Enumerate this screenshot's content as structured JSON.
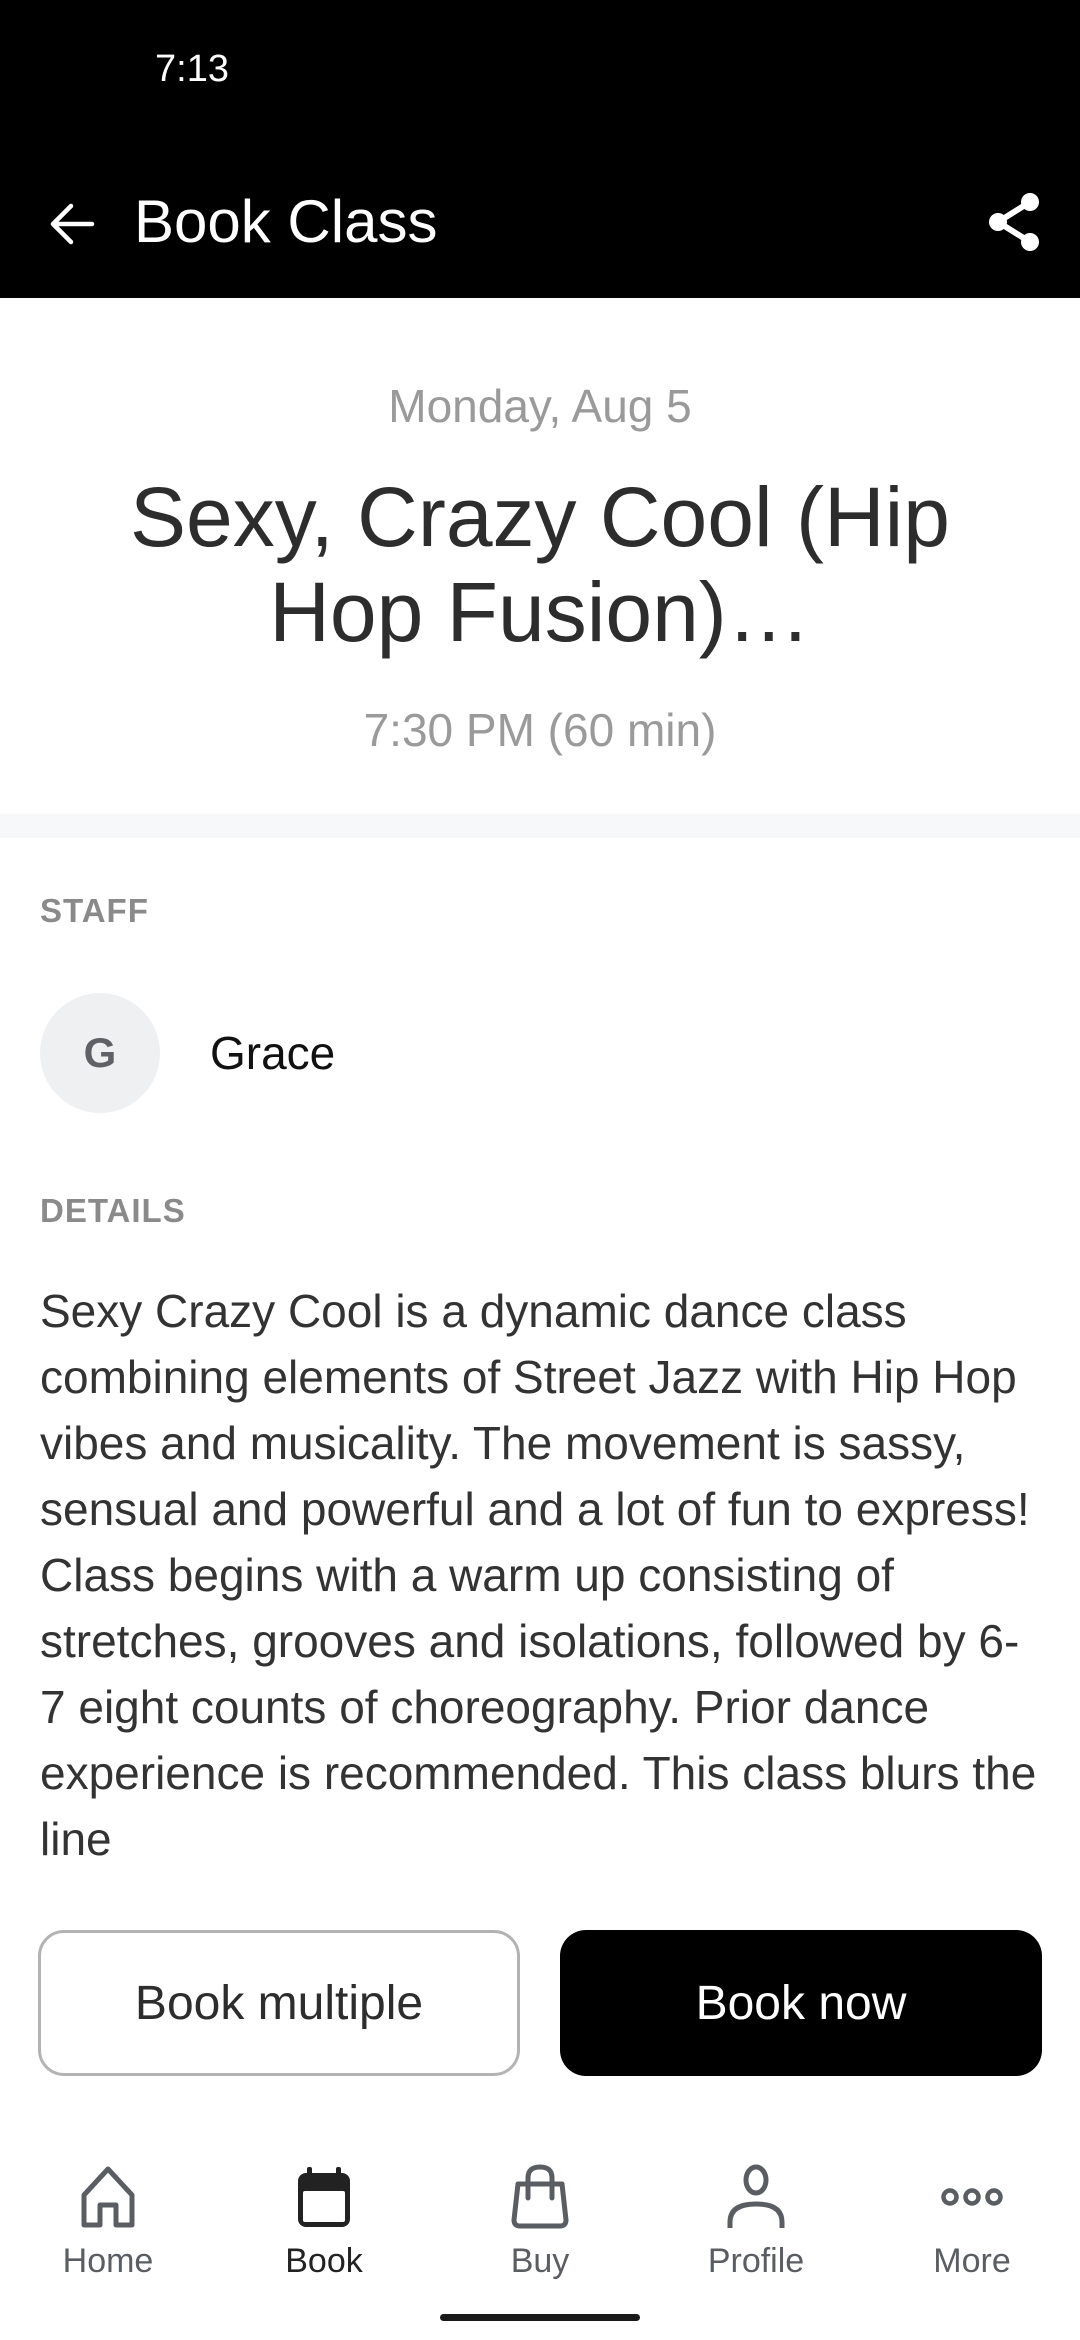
{
  "status_bar": {
    "time": "7:13"
  },
  "header": {
    "title": "Book Class",
    "back_icon": "arrow-left-icon",
    "share_icon": "share-icon"
  },
  "class_info": {
    "date": "Monday, Aug 5",
    "title": "Sexy, Crazy Cool (Hip Hop Fusion)…",
    "time": "7:30 PM (60 min)"
  },
  "staff": {
    "label": "STAFF",
    "members": [
      {
        "initial": "G",
        "name": "Grace"
      }
    ]
  },
  "details": {
    "label": "DETAILS",
    "text": "Sexy Crazy Cool is a dynamic dance class combining elements of Street Jazz with Hip Hop vibes and musicality. The movement is sassy, sensual and powerful and a lot of fun to express! Class begins with a warm up consisting of stretches, grooves and isolations, followed by 6-7 eight counts of choreography. Prior dance experience is recommended. This class blurs the line"
  },
  "actions": {
    "book_multiple": "Book multiple",
    "book_now": "Book now"
  },
  "bottom_nav": {
    "active": "Book",
    "items": [
      {
        "label": "Home",
        "icon": "home-icon"
      },
      {
        "label": "Book",
        "icon": "calendar-icon"
      },
      {
        "label": "Buy",
        "icon": "shopping-bag-icon"
      },
      {
        "label": "Profile",
        "icon": "person-icon"
      },
      {
        "label": "More",
        "icon": "more-dots-icon"
      }
    ]
  },
  "colors": {
    "header_bg": "#000000",
    "primary_button": "#000000",
    "muted_text": "#9a9a9a",
    "band": "#f7f8f9"
  }
}
